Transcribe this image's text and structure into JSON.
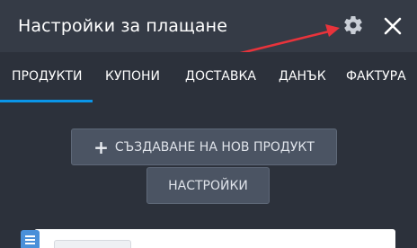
{
  "header": {
    "title": "Настройки за плащане",
    "gear_icon": "gear-icon",
    "close_icon": "close-icon"
  },
  "annotation": {
    "arrow_color": "#e8333b"
  },
  "tabs": [
    {
      "label": "ПРОДУКТИ",
      "active": true
    },
    {
      "label": "КУПОНИ",
      "active": false
    },
    {
      "label": "ДОСТАВКА",
      "active": false
    },
    {
      "label": "ДАНЪК",
      "active": false
    },
    {
      "label": "ФАКТУРА",
      "active": false
    }
  ],
  "colors": {
    "accent": "#0a95e8",
    "header_bg": "#353b46",
    "body_bg": "#2c313b",
    "button_bg": "#4b5463"
  },
  "main": {
    "add_product_label": "СЪЗДАВАНЕ НА НОВ ПРОДУКТ",
    "settings_label": "НАСТРОЙКИ",
    "list_icon": "list-icon"
  }
}
